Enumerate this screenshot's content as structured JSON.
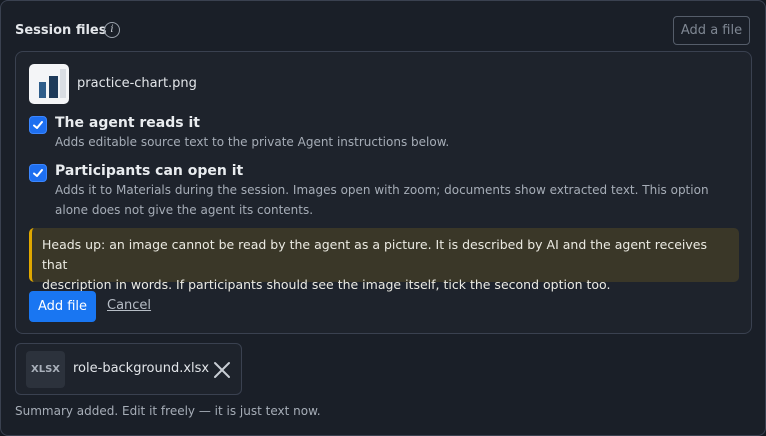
{
  "header": {
    "title": "Session files",
    "info_icon": "info-icon",
    "add_file_label": "Add a file"
  },
  "pending_file": {
    "name": "practice-chart.png",
    "thumbnail_icon": "image-thumbnail",
    "options": [
      {
        "title": "The agent reads it",
        "description": "Adds editable source text to the private Agent instructions below.",
        "checked": true
      },
      {
        "title": "Participants can open it",
        "description_line1": "Adds it to Materials during the session. Images open with zoom; documents show extracted text. This option",
        "description_line2": "alone does not give the agent its contents.",
        "checked": true
      }
    ],
    "notice_line1": "Heads up: an image cannot be read by the agent as a picture. It is described by AI and the agent receives that",
    "notice_line2": "description in words. If participants should see the image itself, tick the second option too.",
    "add_label": "Add file",
    "cancel_label": "Cancel"
  },
  "attached_file": {
    "type": "XLSX",
    "name": "role-background.xlsx",
    "remove_icon": "close-icon"
  },
  "summary_text": "Summary added. Edit it freely — it is just text now.",
  "colors": {
    "accent": "#1976f2",
    "notice_border": "#e0a800",
    "notice_bg": "#3a3728"
  }
}
